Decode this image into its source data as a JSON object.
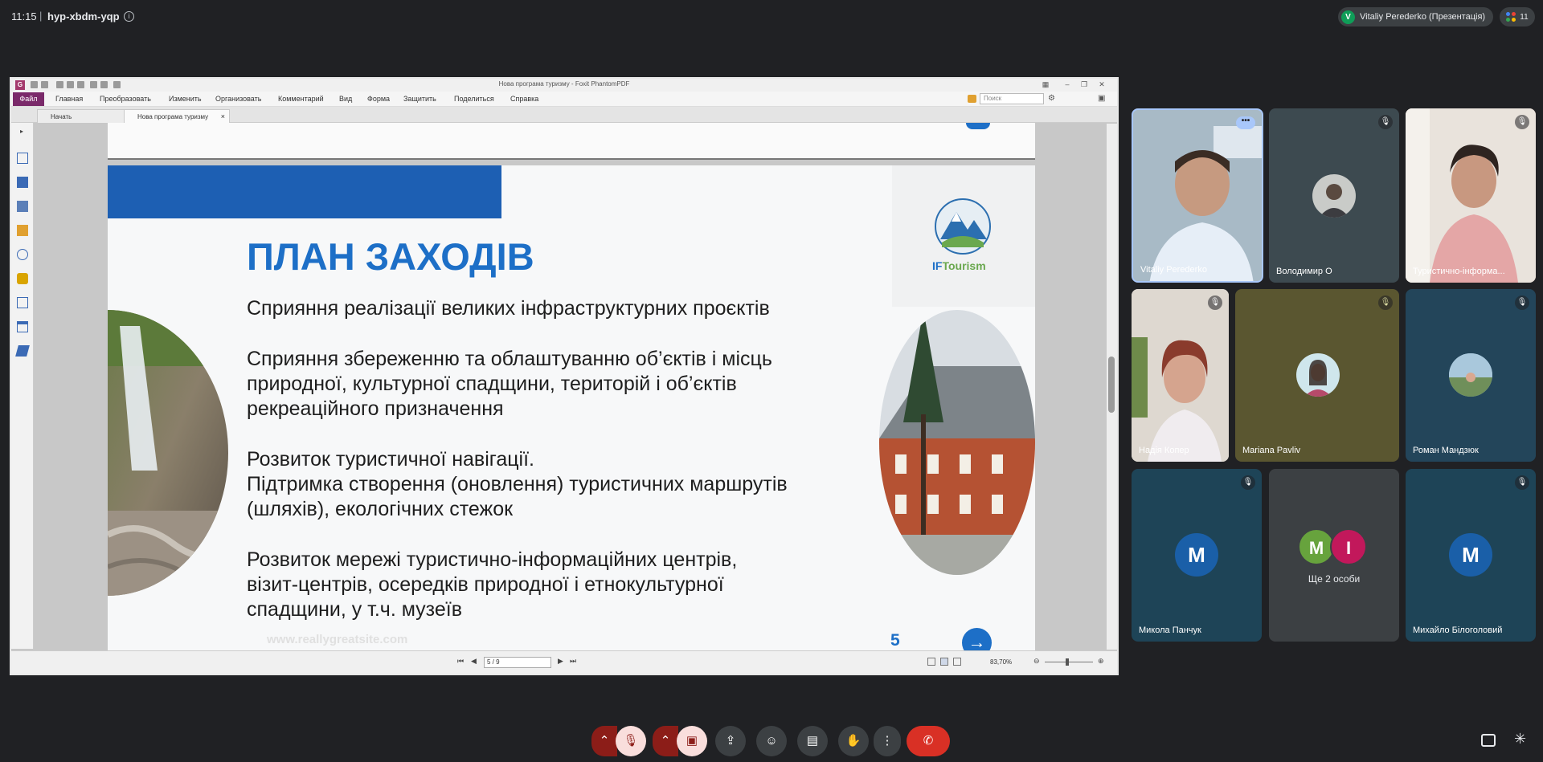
{
  "meet": {
    "time": "11:15",
    "separator": "|",
    "code": "hyp-xbdm-yqp",
    "presenter_initial": "V",
    "presenter_label": "Vitaliy Perederko (Презентація)",
    "participants_count": "11"
  },
  "pdf_app": {
    "window_title": "Нова програма туризму - Foxit PhantomPDF",
    "menu": [
      "Файл",
      "Главная",
      "Преобразовать",
      "Изменить",
      "Организовать",
      "Комментарий",
      "Вид",
      "Форма",
      "Защитить",
      "Поделиться",
      "Справка"
    ],
    "search_placeholder": "Поиск",
    "tabs": [
      "Начать",
      "Нова програма туризму"
    ],
    "tab_close": "×",
    "page_indicator": "5 / 9",
    "zoom": "83,70%"
  },
  "slide": {
    "title": "ПЛАН ЗАХОДІВ",
    "bullets": [
      [
        "Сприяння реалізації великих інфраструктурних проєктів"
      ],
      [
        "Сприяння збереженню та облаштуванню об’єктів і місць",
        "природної, культурної спадщини, територій і об’єктів",
        "рекреаційного призначення"
      ],
      [
        "Розвиток туристичної навігації.",
        "Підтримка створення (оновлення) туристичних маршрутів",
        "(шляхів), екологічних стежок"
      ],
      [
        "Розвиток мережі туристично-інформаційних центрів,",
        "візит-центрів, осередків природної і етнокультурної",
        "спадщини, у т.ч. музеїв"
      ]
    ],
    "logo_prefix": "IF",
    "logo_suffix": "Tourism",
    "page_number": "5",
    "next_arrow": "→",
    "footer_url": "www.reallygreatsite.com"
  },
  "participants": [
    {
      "name": "Vitaliy Perederko"
    },
    {
      "name": "Володимир О"
    },
    {
      "name": "Туристично-інформа..."
    },
    {
      "name": "Надія Копер"
    },
    {
      "name": "Mariana Pavliv"
    },
    {
      "name": "Роман Мандзюк"
    },
    {
      "name": "Микола Панчук",
      "initial": "M"
    },
    {
      "name": "Ще 2 особи",
      "initials": [
        "M",
        "I"
      ]
    },
    {
      "name": "Михайло Білоголовий",
      "initial": "M"
    }
  ],
  "colors": {
    "meet_bg": "#202124",
    "slide_accent": "#1d6fc7",
    "end_call": "#d93025",
    "active_speaker": "#a8c7fa"
  }
}
